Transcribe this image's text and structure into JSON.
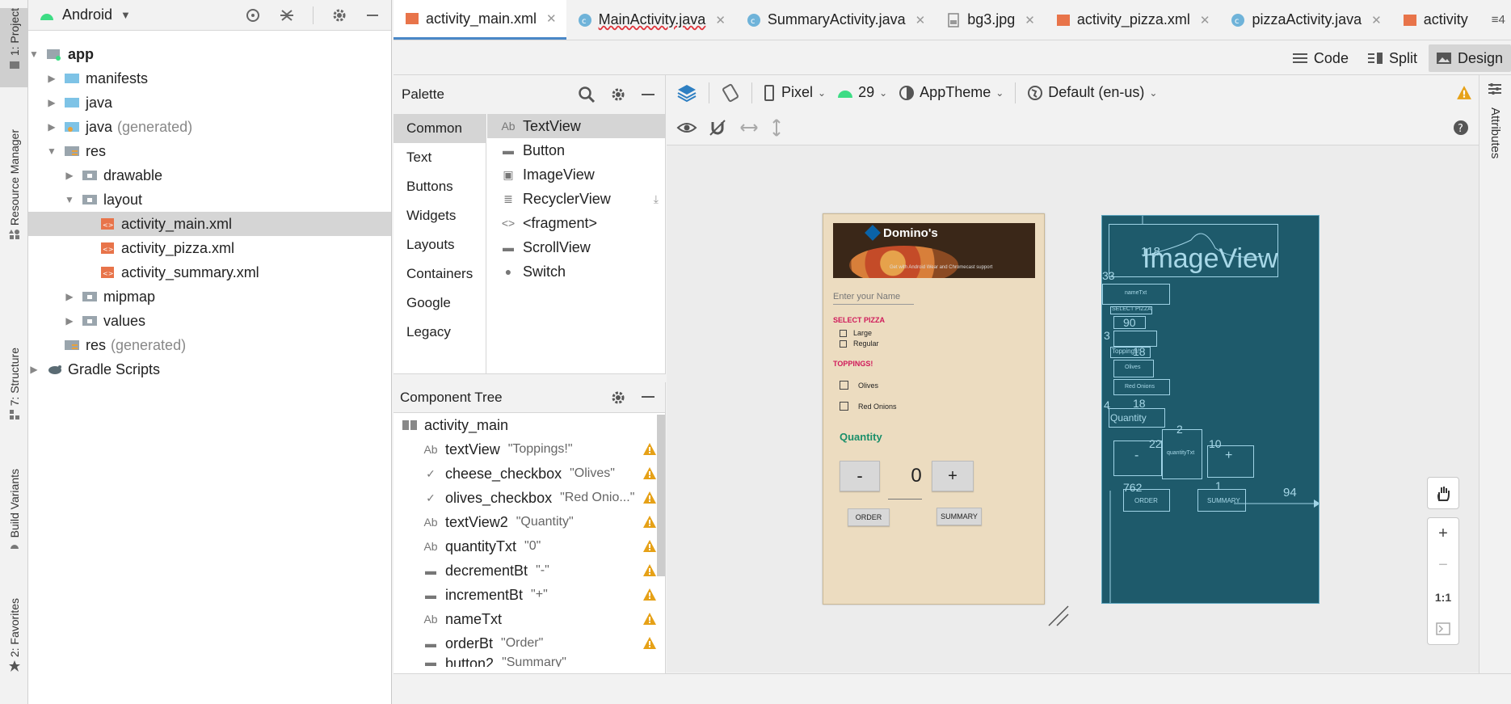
{
  "left_strip": {
    "tabs": [
      {
        "label": "1: Project"
      },
      {
        "label": "Resource Manager"
      },
      {
        "label": "7: Structure"
      },
      {
        "label": "Build Variants"
      },
      {
        "label": "2: Favorites"
      }
    ]
  },
  "project": {
    "view_selector": "Android",
    "tree": [
      {
        "label": "app",
        "extra": ""
      },
      {
        "label": "manifests",
        "extra": ""
      },
      {
        "label": "java",
        "extra": ""
      },
      {
        "label": "java",
        "extra": "(generated)"
      },
      {
        "label": "res",
        "extra": ""
      },
      {
        "label": "drawable",
        "extra": ""
      },
      {
        "label": "layout",
        "extra": ""
      },
      {
        "label": "activity_main.xml",
        "extra": ""
      },
      {
        "label": "activity_pizza.xml",
        "extra": ""
      },
      {
        "label": "activity_summary.xml",
        "extra": ""
      },
      {
        "label": "mipmap",
        "extra": ""
      },
      {
        "label": "values",
        "extra": ""
      },
      {
        "label": "res",
        "extra": "(generated)"
      },
      {
        "label": "Gradle Scripts",
        "extra": ""
      }
    ]
  },
  "tabs": [
    {
      "label": "activity_main.xml"
    },
    {
      "label": "MainActivity.java"
    },
    {
      "label": "SummaryActivity.java"
    },
    {
      "label": "bg3.jpg"
    },
    {
      "label": "activity_pizza.xml"
    },
    {
      "label": "pizzaActivity.java"
    },
    {
      "label": "activity"
    }
  ],
  "tab_overflow": "≡4",
  "view_modes": {
    "code": "Code",
    "split": "Split",
    "design": "Design"
  },
  "palette": {
    "title": "Palette",
    "categories": [
      "Common",
      "Text",
      "Buttons",
      "Widgets",
      "Layouts",
      "Containers",
      "Google",
      "Legacy"
    ],
    "items": [
      {
        "icon": "Ab",
        "label": "TextView"
      },
      {
        "icon": "▬",
        "label": "Button"
      },
      {
        "icon": "▣",
        "label": "ImageView"
      },
      {
        "icon": "≣",
        "label": "RecyclerView"
      },
      {
        "icon": "<>",
        "label": "<fragment>"
      },
      {
        "icon": "▬",
        "label": "ScrollView"
      },
      {
        "icon": "●",
        "label": "Switch"
      }
    ]
  },
  "component_tree": {
    "title": "Component Tree",
    "root": "activity_main",
    "rows": [
      {
        "icon": "Ab",
        "id": "textView",
        "text": "\"Toppings!\""
      },
      {
        "icon": "✓",
        "id": "cheese_checkbox",
        "text": "\"Olives\""
      },
      {
        "icon": "✓",
        "id": "olives_checkbox",
        "text": "\"Red Onio...\""
      },
      {
        "icon": "Ab",
        "id": "textView2",
        "text": "\"Quantity\""
      },
      {
        "icon": "Ab",
        "id": "quantityTxt",
        "text": "\"0\""
      },
      {
        "icon": "▬",
        "id": "decrementBt",
        "text": "\"-\""
      },
      {
        "icon": "▬",
        "id": "incrementBt",
        "text": "\"+\""
      },
      {
        "icon": "Ab",
        "id": "nameTxt",
        "text": ""
      },
      {
        "icon": "▬",
        "id": "orderBt",
        "text": "\"Order\""
      },
      {
        "icon": "▬",
        "id": "button2",
        "text": "\"Summary\""
      }
    ]
  },
  "toolbar": {
    "device": "Pixel",
    "api": "29",
    "theme": "AppTheme",
    "locale": "Default (en-us)"
  },
  "right_strip": {
    "label": "Attributes"
  },
  "phone": {
    "brand": "Domino's",
    "tagline": "Get with Android Wear and Chromecast support",
    "name_hint": "Enter your Name",
    "select_pizza": "SELECT PIZZA",
    "large": "Large",
    "regular": "Regular",
    "toppings": "TOPPINGS!",
    "olives": "Olives",
    "red_onions": "Red Onions",
    "quantity": "Quantity",
    "minus": "-",
    "zero": "0",
    "plus": "+",
    "order": "ORDER",
    "summary": "SUMMARY"
  },
  "blueprint": {
    "imageview": "ImageView",
    "n118": "118",
    "n33": "33",
    "nametxt": "nameTxt",
    "select_pizza": "SELECT PIZZA",
    "n90": "90",
    "n3": "3",
    "toppings": "Toppings!",
    "n18a": "18",
    "olives": "Olives",
    "red_onions": "Red Onions",
    "n4": "4",
    "n18b": "18",
    "quantity": "Quantity",
    "n2": "2",
    "n22": "22",
    "n10": "10",
    "minus": "-",
    "quantitytxt": "quantityTxt",
    "plus": "+",
    "n762": "762",
    "n1": "1",
    "n94": "94",
    "order": "ORDER",
    "summary": "SUMMARY"
  },
  "zoom": {
    "plus": "+",
    "minus": "−",
    "one_to_one": "1:1"
  },
  "colors": {
    "accent_blue": "#4a88c7",
    "warning": "#e6a117",
    "blueprint_bg": "#1e5a6b",
    "phone_bg": "#ecdcc0",
    "pink_label": "#d01a5a",
    "green_label": "#1a8f6a"
  }
}
